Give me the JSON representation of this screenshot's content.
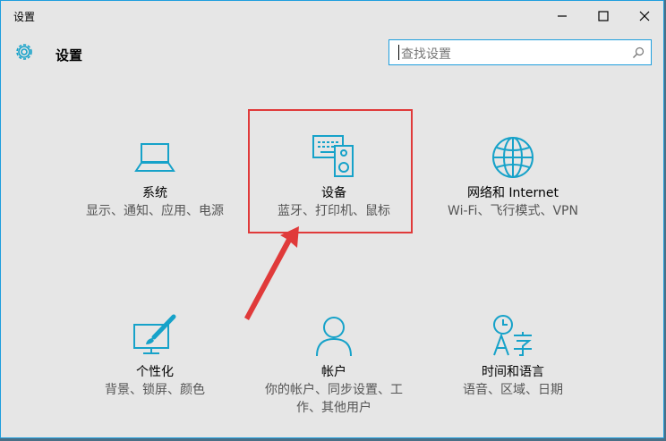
{
  "window": {
    "title": "设置"
  },
  "header": {
    "title": "设置",
    "search_placeholder": "查找设置"
  },
  "tiles": [
    {
      "title": "系统",
      "subtitle": "显示、通知、应用、电源"
    },
    {
      "title": "设备",
      "subtitle": "蓝牙、打印机、鼠标"
    },
    {
      "title": "网络和 Internet",
      "subtitle": "Wi-Fi、飞行模式、VPN"
    },
    {
      "title": "个性化",
      "subtitle": "背景、锁屏、颜色"
    },
    {
      "title": "帐户",
      "subtitle": "你的帐户、同步设置、工作、其他用户"
    },
    {
      "title": "时间和语言",
      "subtitle": "语音、区域、日期"
    }
  ],
  "colors": {
    "accent": "#1e9edd",
    "icon": "#16a2c9",
    "annotation": "#e03a3a"
  }
}
